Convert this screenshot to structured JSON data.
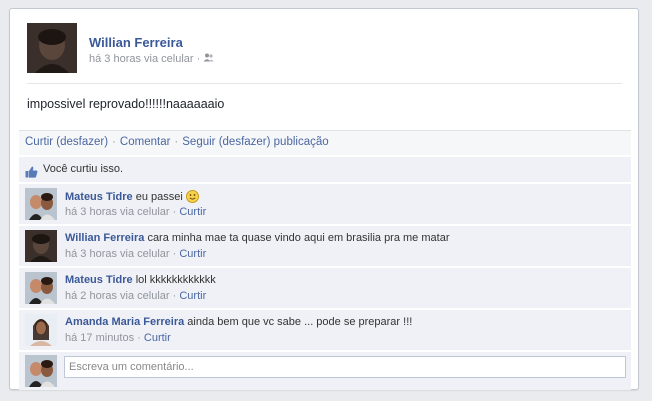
{
  "post": {
    "author": "Willian Ferreira",
    "time": "há 3 horas via celular",
    "dot": "·",
    "text": "impossivel reprovado!!!!!!naaaaaaio"
  },
  "actions": {
    "like": "Curtir (desfazer)",
    "comment": "Comentar",
    "follow": "Seguir (desfazer) publicação",
    "separator": "·"
  },
  "likes": {
    "text": "Você curtiu isso."
  },
  "comments": [
    {
      "author": "Mateus Tidre",
      "text": "eu passei",
      "emoji": true,
      "time": "há 3 horas via celular",
      "like": "Curtir"
    },
    {
      "author": "Willian Ferreira",
      "text": "cara minha mae ta quase vindo aqui em brasilia pra me matar",
      "emoji": false,
      "time": "há 3 horas via celular",
      "like": "Curtir"
    },
    {
      "author": "Mateus Tidre",
      "text": "lol kkkkkkkkkkkk",
      "emoji": false,
      "time": "há 2 horas via celular",
      "like": "Curtir"
    },
    {
      "author": "Amanda Maria Ferreira",
      "text": "ainda bem que vc sabe ... pode se preparar !!!",
      "emoji": false,
      "time": "há 17 minutos",
      "like": "Curtir"
    }
  ],
  "composer": {
    "placeholder": "Escreva um comentário..."
  },
  "colors": {
    "link": "#3b5998",
    "commentBg": "#eff1f6",
    "meta": "#90949c"
  }
}
